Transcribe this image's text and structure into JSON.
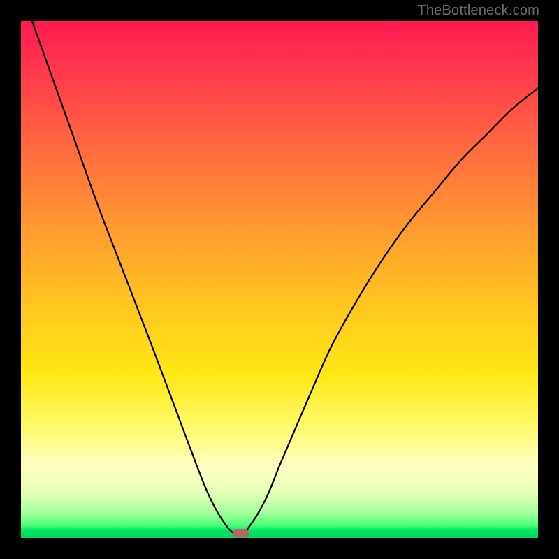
{
  "watermark": "TheBottleneck.com",
  "chart_data": {
    "type": "line",
    "title": "",
    "xlabel": "",
    "ylabel": "",
    "xlim": [
      0,
      100
    ],
    "ylim": [
      0,
      100
    ],
    "grid": false,
    "legend": false,
    "background_gradient": {
      "top": "#ff1a52",
      "mid1": "#ff9a2f",
      "mid2": "#ffe714",
      "mid3": "#ffffc0",
      "bottom": "#00d65e"
    },
    "series": [
      {
        "name": "bottleneck-curve",
        "color": "#000000",
        "x": [
          0,
          5,
          10,
          15,
          20,
          25,
          28,
          31,
          34,
          36,
          38,
          40,
          41,
          42,
          43,
          44,
          46,
          48,
          50,
          53,
          56,
          60,
          65,
          70,
          75,
          80,
          85,
          90,
          95,
          100
        ],
        "y_pct": [
          106,
          92,
          78,
          64,
          51,
          38,
          30,
          22,
          14,
          9,
          5,
          2,
          1,
          0.3,
          0.7,
          2,
          5,
          9,
          14,
          21,
          28,
          37,
          46,
          54,
          61,
          67,
          73,
          78,
          83,
          87
        ]
      }
    ],
    "marker": {
      "name": "optimum-marker",
      "x": 42.5,
      "width_pct": 3.2,
      "height_pct": 1.6,
      "color": "#c06060"
    }
  }
}
